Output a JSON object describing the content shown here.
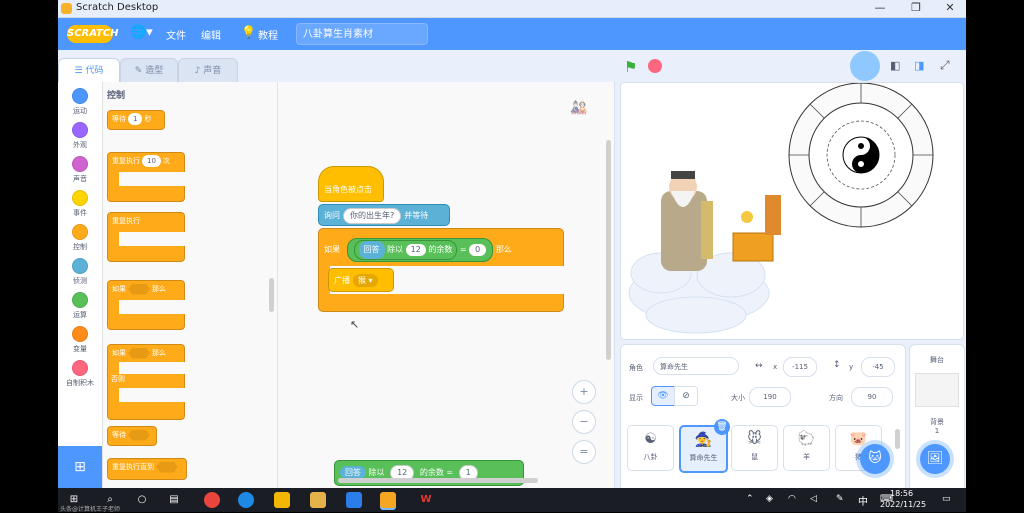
{
  "window": {
    "title": "Scratch Desktop"
  },
  "menubar": {
    "logo": "SCRATCH",
    "file": "文件",
    "edit": "编辑",
    "tutorials": "教程",
    "project_title": "八卦算生肖素材"
  },
  "tabs": {
    "code": "代码",
    "costumes": "造型",
    "sounds": "声音"
  },
  "categories": [
    {
      "label": "运动",
      "color": "#4c97ff"
    },
    {
      "label": "外观",
      "color": "#9966ff"
    },
    {
      "label": "声音",
      "color": "#cf63cf"
    },
    {
      "label": "事件",
      "color": "#ffd500"
    },
    {
      "label": "控制",
      "color": "#ffab19"
    },
    {
      "label": "侦测",
      "color": "#5cb1d6"
    },
    {
      "label": "运算",
      "color": "#59c059"
    },
    {
      "label": "变量",
      "color": "#ff8c1a"
    },
    {
      "label": "自制积木",
      "color": "#ff6680"
    }
  ],
  "palette": {
    "title": "控制",
    "wait": {
      "label": "等待",
      "value": "1",
      "unit": "秒"
    },
    "repeat": {
      "label": "重复执行",
      "value": "10",
      "unit": "次"
    },
    "forever": {
      "label": "重复执行"
    },
    "if_then": {
      "label": "如果",
      "then": "那么"
    },
    "if_else": {
      "label": "如果",
      "then": "那么",
      "else": "否则"
    },
    "wait_until": {
      "label": "等待"
    },
    "repeat_until": {
      "label": "重复执行直到"
    }
  },
  "script": {
    "hat": "当角色被点击",
    "ask": {
      "label": "询问",
      "question": "你的出生年?",
      "suffix": "并等待"
    },
    "if": {
      "label": "如果",
      "answer": "回答",
      "mod": "除以",
      "mod_value": "12",
      "remainder": "的余数",
      "eq": "=",
      "eq_value": "0",
      "then": "那么"
    },
    "broadcast": {
      "label": "广播",
      "message": "猴"
    },
    "bottom_block": {
      "answer": "回答",
      "mod": "除以",
      "mod_value": "12",
      "remainder": "的余数",
      "eq": "=",
      "eq_value": "1"
    }
  },
  "zoom": {
    "in": "+",
    "out": "−",
    "reset": "="
  },
  "sprite_info": {
    "sprite_label": "角色",
    "sprite_name": "算命先生",
    "x_label": "x",
    "x": "-115",
    "y_label": "y",
    "y": "-45",
    "show_label": "显示",
    "size_label": "大小",
    "size": "190",
    "direction_label": "方向",
    "direction": "90"
  },
  "sprites": [
    {
      "name": "八卦"
    },
    {
      "name": "算命先生"
    },
    {
      "name": "鼠"
    },
    {
      "name": "羊"
    },
    {
      "name": "猪"
    }
  ],
  "stage_panel": {
    "label": "舞台",
    "backdrops_label": "背景",
    "backdrops_count": "1"
  },
  "taskbar": {
    "time": "18:56",
    "date": "2022/11/25",
    "ime": "中"
  },
  "watermark": "头条@计算机王子老师"
}
